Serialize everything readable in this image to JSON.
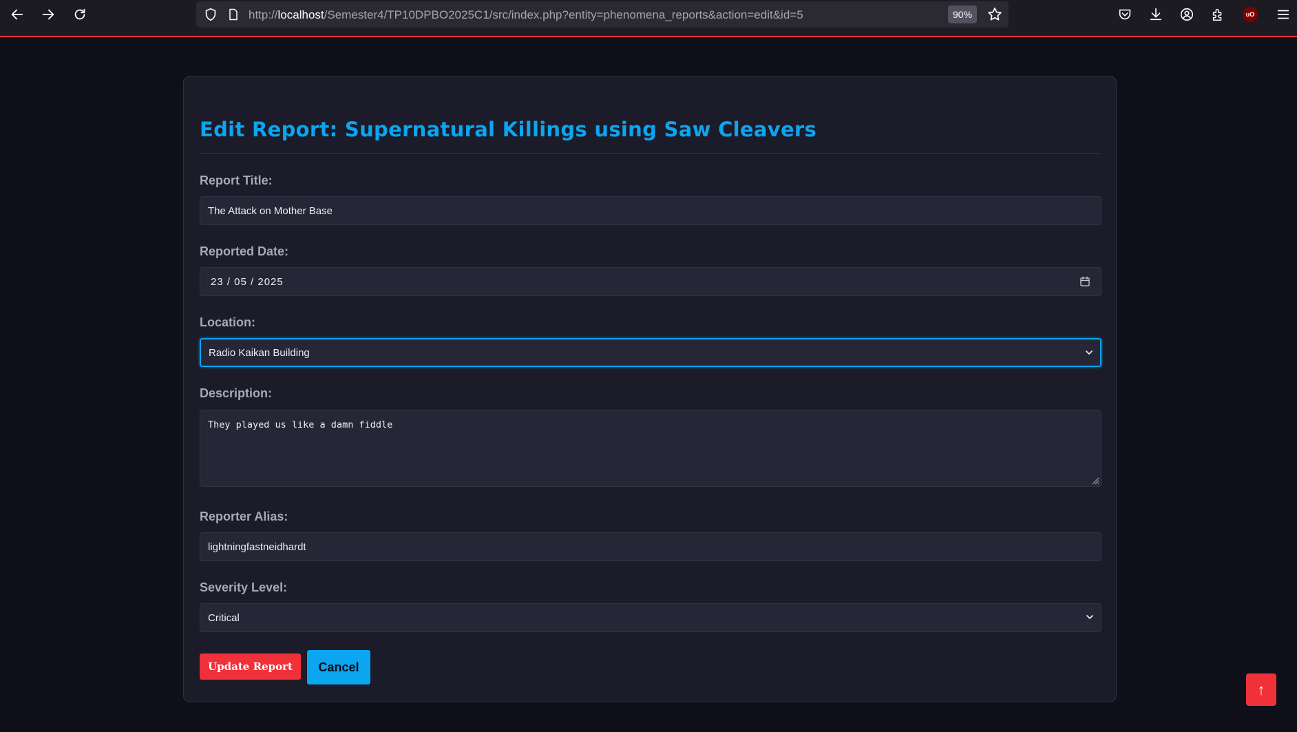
{
  "browser": {
    "url_prefix": "http://",
    "url_host": "localhost",
    "url_path": "/Semester4/TP10DPBO2025C1/src/index.php?entity=phenomena_reports&action=edit&id=5",
    "zoom": "90%"
  },
  "form": {
    "heading": "Edit Report: Supernatural Killings using Saw Cleavers",
    "report_title_label": "Report Title:",
    "report_title_value": "The Attack on Mother Base",
    "reported_date_label": "Reported Date:",
    "reported_date_value": "23 / 05 / 2025",
    "location_label": "Location:",
    "location_value": "Radio Kaikan Building",
    "description_label": "Description:",
    "description_value": "They played us like a damn fiddle",
    "reporter_alias_label": "Reporter Alias:",
    "reporter_alias_value": "lightningfastneidhardt",
    "severity_label": "Severity Level:",
    "severity_value": "Critical",
    "update_label": "Update Report",
    "cancel_label": "Cancel"
  },
  "scroll_top_label": "↑",
  "colors": {
    "accent_blue": "#0ba5f0",
    "accent_red": "#f0313a",
    "background": "#0f0f1a",
    "card": "#1b1b29"
  },
  "icons": [
    "back-icon",
    "forward-icon",
    "reload-icon",
    "shield-icon",
    "page-icon",
    "star-icon",
    "pocket-icon",
    "download-icon",
    "account-icon",
    "extensions-icon",
    "ublock-icon",
    "menu-icon",
    "calendar-icon",
    "chevron-down-icon"
  ]
}
